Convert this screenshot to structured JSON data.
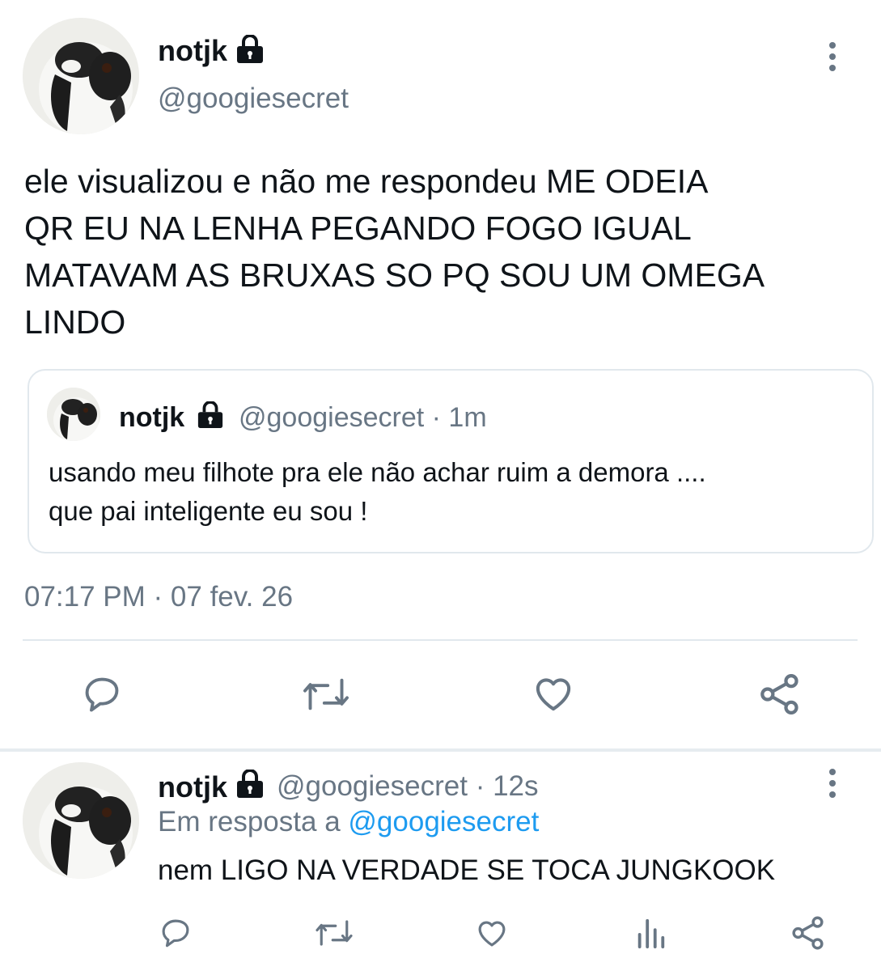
{
  "main_tweet": {
    "display_name": "notjk",
    "handle": "@googiesecret",
    "text_lines": [
      "ele visualizou e não me respondeu ME ODEIA",
      "QR EU NA LENHA PEGANDO FOGO IGUAL",
      "MATAVAM AS BRUXAS SO PQ SOU UM OMEGA",
      "LINDO"
    ],
    "timestamp": "07:17 PM · 07 fev. 26",
    "quoted": {
      "display_name": "notjk",
      "handle": "@googiesecret",
      "time": "· 1m",
      "text_lines": [
        "usando meu filhote pra ele não achar ruim a demora ....",
        "que pai inteligente eu sou !"
      ]
    }
  },
  "reply_tweet": {
    "display_name": "notjk",
    "handle": "@googiesecret",
    "time": "· 12s",
    "reply_prefix": "Em resposta a",
    "reply_to": "@googiesecret",
    "text": "nem LIGO NA VERDADE SE TOCA JUNGKOOK"
  },
  "icons": {
    "reply": "reply-icon",
    "retweet": "retweet-icon",
    "like": "like-icon",
    "share": "share-icon",
    "analytics": "analytics-icon",
    "lock": "lock-icon",
    "more": "more-dots-icon"
  },
  "colors": {
    "text": "#0f1419",
    "secondary": "#687684",
    "link": "#1d9bf0",
    "divider": "#e1e8ed",
    "icon": "#687684"
  }
}
